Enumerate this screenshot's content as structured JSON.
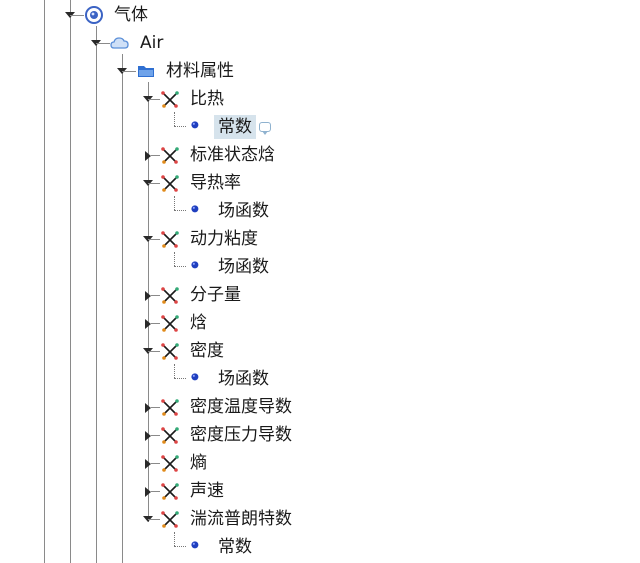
{
  "tree": {
    "gas": {
      "label": "气体",
      "icon": "gas-target-icon",
      "expanded": true
    },
    "air": {
      "label": "Air",
      "icon": "cloud-icon",
      "expanded": true
    },
    "material_props": {
      "label": "材料属性",
      "icon": "folder-icon",
      "expanded": true
    },
    "properties": [
      {
        "label": "比热",
        "icon": "property-graph-icon",
        "expanded": true,
        "child": {
          "label": "常数",
          "icon": "value-dot-icon",
          "selected": true,
          "tooltip_icon": "comment-icon"
        }
      },
      {
        "label": "标准状态焓",
        "icon": "property-graph-icon",
        "expanded": false
      },
      {
        "label": "导热率",
        "icon": "property-graph-icon",
        "expanded": true,
        "child": {
          "label": "场函数",
          "icon": "value-dot-icon"
        }
      },
      {
        "label": "动力粘度",
        "icon": "property-graph-icon",
        "expanded": true,
        "child": {
          "label": "场函数",
          "icon": "value-dot-icon"
        }
      },
      {
        "label": "分子量",
        "icon": "property-graph-icon",
        "expanded": false
      },
      {
        "label": "焓",
        "icon": "property-graph-icon",
        "expanded": false
      },
      {
        "label": "密度",
        "icon": "property-graph-icon",
        "expanded": true,
        "child": {
          "label": "场函数",
          "icon": "value-dot-icon"
        }
      },
      {
        "label": "密度温度导数",
        "icon": "property-graph-icon",
        "expanded": false
      },
      {
        "label": "密度压力导数",
        "icon": "property-graph-icon",
        "expanded": false
      },
      {
        "label": "熵",
        "icon": "property-graph-icon",
        "expanded": false
      },
      {
        "label": "声速",
        "icon": "property-graph-icon",
        "expanded": false
      },
      {
        "label": "湍流普朗特数",
        "icon": "property-graph-icon",
        "expanded": true,
        "child": {
          "label": "常数",
          "icon": "value-dot-icon"
        }
      }
    ]
  },
  "colors": {
    "tree_line": "#8a8a8a",
    "selection_bg": "#d6e3ec",
    "dot_blue": "#1f3fbf",
    "folder_blue": "#2f6fd1",
    "cloud_blue": "#5b8fd8"
  }
}
